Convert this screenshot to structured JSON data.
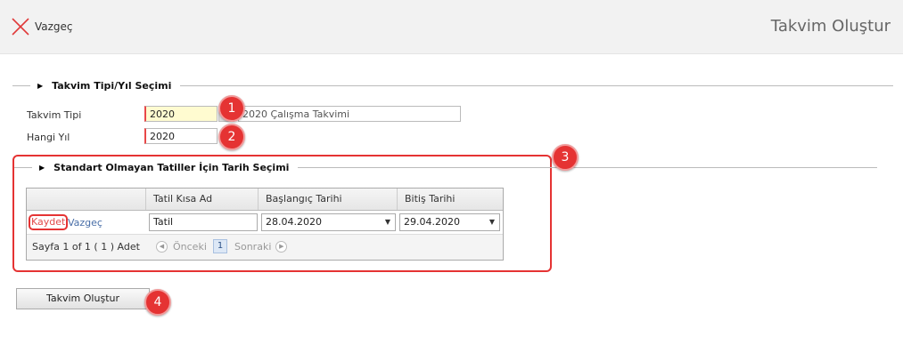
{
  "toolbar": {
    "cancel_label": "Vazgeç"
  },
  "page_title": "Takvim Oluştur",
  "section1": {
    "title": "Takvim Tipi/Yıl Seçimi",
    "calendar_type_label": "Takvim Tipi",
    "calendar_type_value": "2020",
    "calendar_type_desc": "2020 Çalışma Takvimi",
    "year_label": "Hangi Yıl",
    "year_value": "2020"
  },
  "section2": {
    "title": "Standart Olmayan Tatiller İçin Tarih Seçimi",
    "columns": [
      "",
      "Tatil Kısa Ad",
      "Başlangıç Tarihi",
      "Bitiş Tarihi"
    ],
    "row": {
      "save_link": "Kaydet",
      "cancel_link": "Vazgeç",
      "short_name": "Tatil",
      "start_date": "28.04.2020",
      "end_date": "29.04.2020"
    },
    "pager": {
      "summary": "Sayfa 1 of 1 ( 1 ) Adet",
      "prev": "Önceki",
      "page": "1",
      "next": "Sonraki"
    }
  },
  "create_button": "Takvim Oluştur",
  "badges": [
    "1",
    "2",
    "3",
    "4"
  ],
  "colors": {
    "accent_red": "#e53333",
    "link_blue": "#4a6fa8",
    "required_red": "#e84848"
  }
}
